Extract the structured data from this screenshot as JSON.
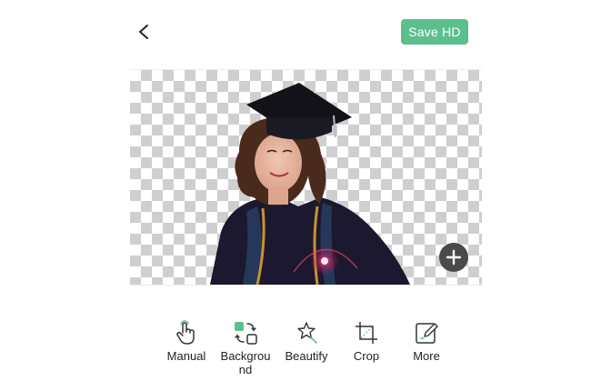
{
  "header": {
    "back_icon": "chevron-left-icon",
    "save_label": "Save HD"
  },
  "colors": {
    "accent": "#5cc08d",
    "fab": "#4a4a4a",
    "text": "#222222"
  },
  "canvas": {
    "background": "transparent-checkerboard",
    "subject": "graduate-in-cap-and-gown-cutout",
    "add_icon": "plus-icon"
  },
  "toolbar": {
    "items": [
      {
        "label": "Manual",
        "icon": "hand-pointer-icon"
      },
      {
        "label": "Backgrou\nnd",
        "icon": "background-swap-icon"
      },
      {
        "label": "Beautify",
        "icon": "magic-wand-star-icon"
      },
      {
        "label": "Crop",
        "icon": "crop-icon"
      },
      {
        "label": "More",
        "icon": "edit-pencil-icon"
      }
    ]
  }
}
